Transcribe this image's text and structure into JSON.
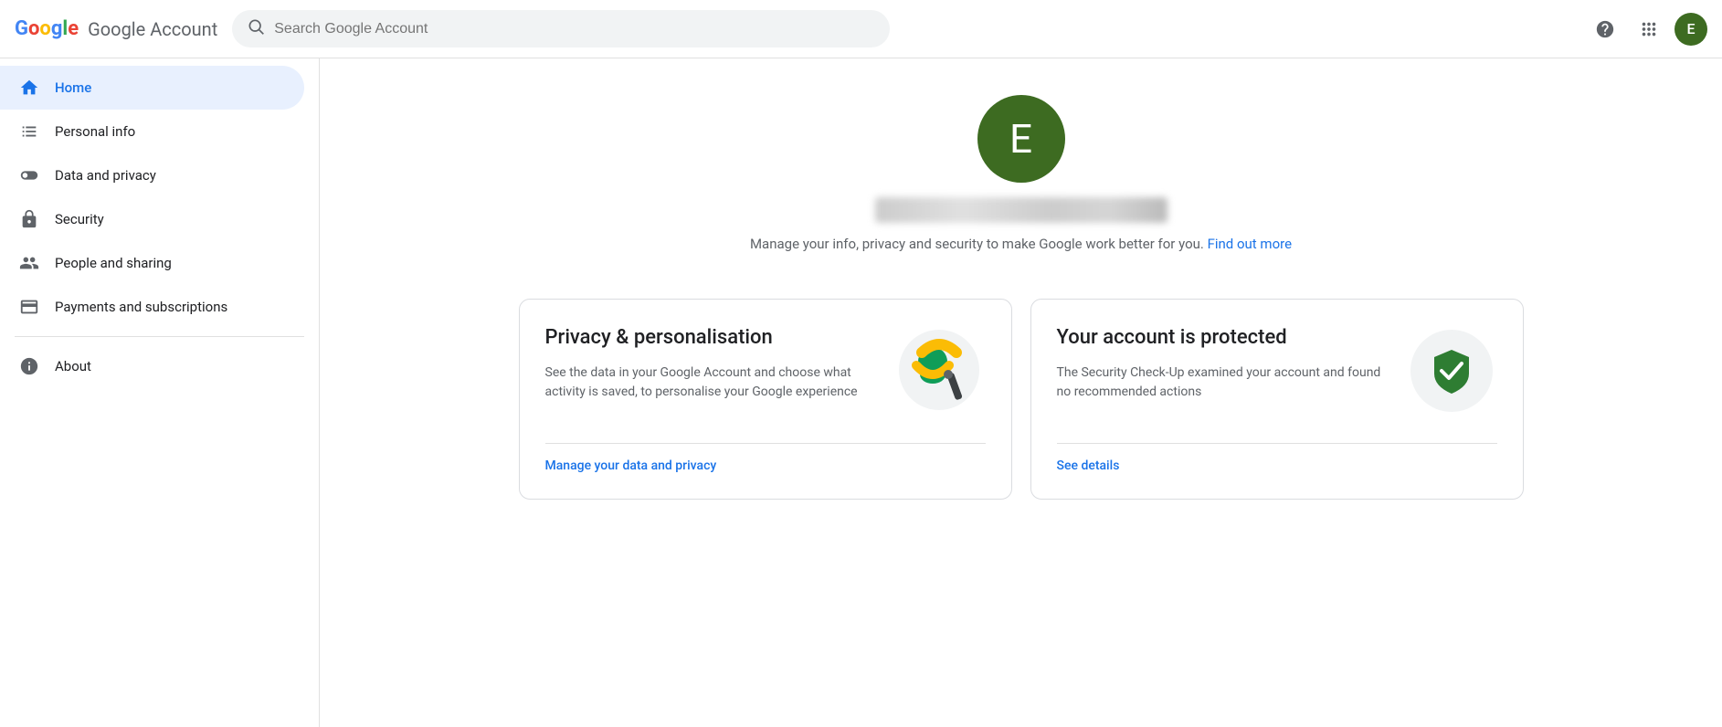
{
  "header": {
    "title": "Google Account",
    "search_placeholder": "Search Google Account",
    "avatar_letter": "E",
    "avatar_bg": "#3d6b21"
  },
  "sidebar": {
    "items": [
      {
        "id": "home",
        "label": "Home",
        "icon": "home",
        "active": true
      },
      {
        "id": "personal-info",
        "label": "Personal info",
        "icon": "person"
      },
      {
        "id": "data-privacy",
        "label": "Data and privacy",
        "icon": "toggle"
      },
      {
        "id": "security",
        "label": "Security",
        "icon": "lock"
      },
      {
        "id": "people-sharing",
        "label": "People and sharing",
        "icon": "people"
      },
      {
        "id": "payments",
        "label": "Payments and subscriptions",
        "icon": "credit-card"
      },
      {
        "id": "about",
        "label": "About",
        "icon": "info"
      }
    ]
  },
  "main": {
    "profile_letter": "E",
    "description": "Manage your info, privacy and security to make Google work better for you.",
    "find_out_more": "Find out more",
    "cards": [
      {
        "id": "privacy",
        "title": "Privacy & personalisation",
        "description": "See the data in your Google Account and choose what activity is saved, to personalise your Google experience",
        "link_label": "Manage your data and privacy"
      },
      {
        "id": "security",
        "title": "Your account is protected",
        "description": "The Security Check-Up examined your account and found no recommended actions",
        "link_label": "See details"
      }
    ]
  }
}
